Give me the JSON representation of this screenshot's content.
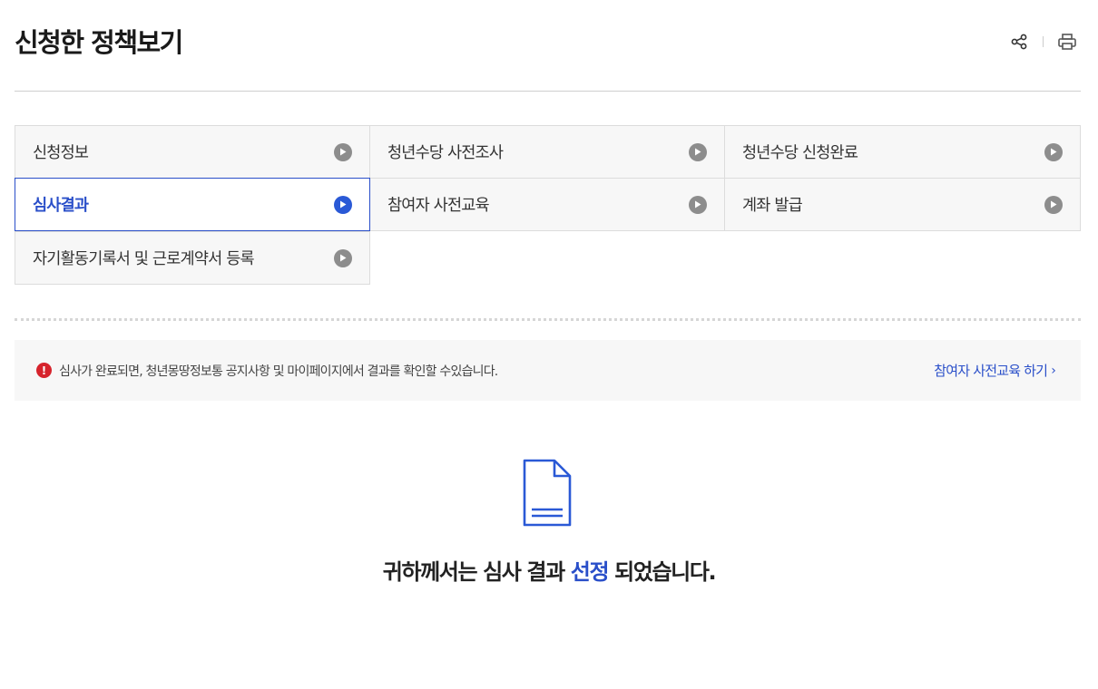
{
  "page": {
    "title": "신청한 정책보기"
  },
  "tools": {
    "share_icon": "share-icon",
    "print_icon": "print-icon"
  },
  "steps": [
    {
      "label": "신청정보",
      "active": false
    },
    {
      "label": "청년수당 사전조사",
      "active": false
    },
    {
      "label": "청년수당 신청완료",
      "active": false
    },
    {
      "label": "심사결과",
      "active": true
    },
    {
      "label": "참여자 사전교육",
      "active": false
    },
    {
      "label": "계좌 발급",
      "active": false
    },
    {
      "label": "자기활동기록서 및 근로계약서 등록",
      "active": false
    }
  ],
  "notice": {
    "icon": "alert-icon",
    "icon_glyph": "!",
    "text": "심사가 완료되면, 청년몽땅정보통 공지사항 및 마이페이지에서 결과를 확인할 수있습니다.",
    "link_label": "참여자 사전교육 하기",
    "link_chevron": "›"
  },
  "result": {
    "icon": "document-icon",
    "text_before": "귀하께서는 심사 결과 ",
    "text_highlight": "선정",
    "text_after": " 되었습니다."
  },
  "colors": {
    "accent": "#2a4fc9",
    "alert": "#d6232c",
    "step_bg": "#f7f7f7",
    "arrow_inactive": "#8d8d8d"
  }
}
